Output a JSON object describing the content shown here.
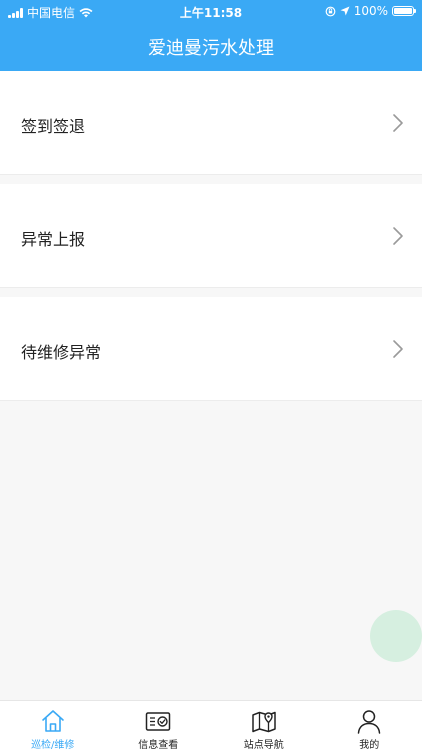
{
  "status_bar": {
    "carrier": "中国电信",
    "time": "上午11:58",
    "battery": "100%",
    "battery_level": 1.0
  },
  "header": {
    "title": "爱迪曼污水处理"
  },
  "menu": {
    "items": [
      {
        "label": "签到签退",
        "icon": "chevron-right-icon"
      },
      {
        "label": "异常上报",
        "icon": "chevron-right-icon"
      },
      {
        "label": "待维修异常",
        "icon": "chevron-right-icon"
      }
    ]
  },
  "tabs": [
    {
      "label": "巡检/维修",
      "icon": "home-icon",
      "active": true
    },
    {
      "label": "信息查看",
      "icon": "info-card-icon",
      "active": false
    },
    {
      "label": "站点导航",
      "icon": "map-icon",
      "active": false
    },
    {
      "label": "我的",
      "icon": "user-icon",
      "active": false
    }
  ],
  "colors": {
    "primary": "#3aa9f5",
    "background": "#f7f7f7",
    "fab": "#d6efe0"
  }
}
